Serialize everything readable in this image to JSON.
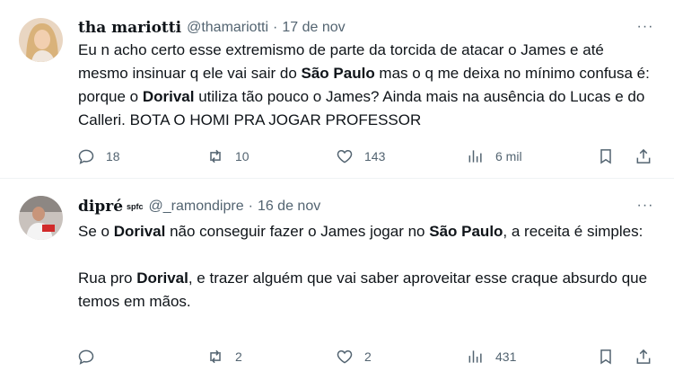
{
  "tweets": [
    {
      "name": "tha mariotti",
      "name_suffix": "",
      "handle": "@thamariotti",
      "separator": "·",
      "date": "17 de nov",
      "more": "···",
      "body": [
        {
          "t": "Eu n acho certo esse extremismo de parte da torcida de atacar o James e até mesmo insinuar q ele vai sair do ",
          "b": false
        },
        {
          "t": "São Paulo",
          "b": true
        },
        {
          "t": " mas o q me deixa no mínimo confusa é: porque o ",
          "b": false
        },
        {
          "t": "Dorival",
          "b": true
        },
        {
          "t": " utiliza tão pouco o James? Ainda mais na ausência do Lucas e do Calleri. BOTA O HOMI PRA JOGAR PROFESSOR",
          "b": false
        }
      ],
      "replies": "18",
      "retweets": "10",
      "likes": "143",
      "views": "6 mil"
    },
    {
      "name": "dipré",
      "name_suffix": "spfc",
      "handle": "@_ramondipre",
      "separator": "·",
      "date": "16 de nov",
      "more": "···",
      "body": [
        {
          "t": "Se o ",
          "b": false
        },
        {
          "t": "Dorival",
          "b": true
        },
        {
          "t": " não conseguir fazer o James jogar no ",
          "b": false
        },
        {
          "t": "São Paulo",
          "b": true
        },
        {
          "t": ", a receita é simples:",
          "b": false
        },
        {
          "br": true
        },
        {
          "br": true
        },
        {
          "t": "Rua pro ",
          "b": false
        },
        {
          "t": "Dorival",
          "b": true
        },
        {
          "t": ", e trazer alguém que vai saber aproveitar esse craque absurdo que temos em mãos.",
          "b": false
        }
      ],
      "replies": "",
      "retweets": "2",
      "likes": "2",
      "views": "431"
    }
  ],
  "colors": {
    "text": "#0f1419",
    "secondary": "#536471",
    "divider": "#eff3f4"
  },
  "icons": [
    "reply-icon",
    "retweet-icon",
    "like-icon",
    "views-icon",
    "bookmark-icon",
    "share-icon",
    "more-icon"
  ]
}
